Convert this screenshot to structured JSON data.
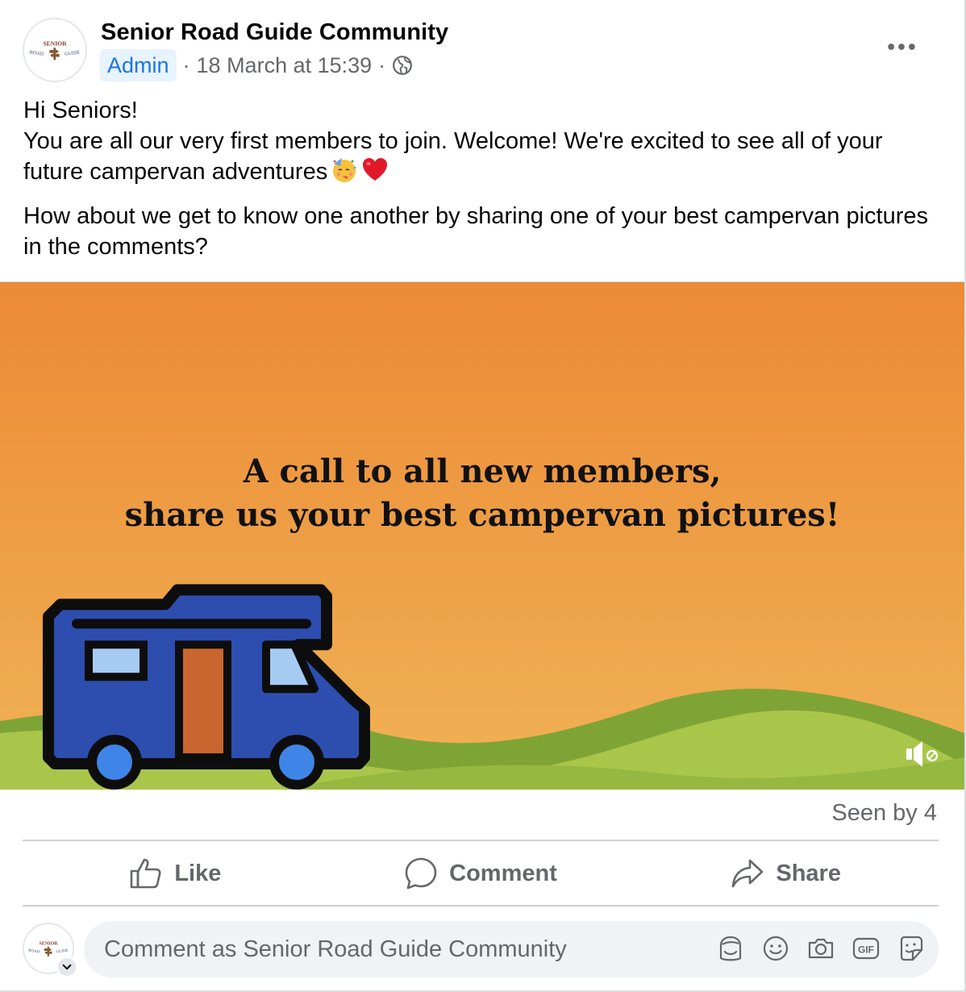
{
  "post": {
    "group_name": "Senior Road Guide Community",
    "role_badge": "Admin",
    "separator": "·",
    "timestamp": "18 March at 15:39",
    "separator2": "·",
    "privacy_icon": "globe-icon",
    "more_icon": "more-options-icon"
  },
  "logo": {
    "line1": "SENIOR",
    "line2": "ROAD",
    "line3": "GUIDE"
  },
  "body": {
    "greeting": "Hi Seniors!",
    "paragraph1": "You are all our very first members to join. Welcome! We're excited to see all of your future campervan adventures",
    "emojis": [
      "partying-face-emoji",
      "red-heart-emoji"
    ],
    "paragraph2": "How about we get to know one another by sharing one of your best campervan pictures in the comments?"
  },
  "media": {
    "headline_line1": "A call to all new members,",
    "headline_line2": "share us your best campervan pictures!",
    "mute_icon": "sound-muted-icon",
    "colors": {
      "sky_top": "#ec8a35",
      "sky_bottom": "#f0b053",
      "hill_dark": "#7fa436",
      "hill_light": "#a9c64a",
      "van": "#2d4eae",
      "door": "#c9652f"
    }
  },
  "stats": {
    "seen_by": "Seen by 4"
  },
  "actions": {
    "like": "Like",
    "comment": "Comment",
    "share": "Share"
  },
  "composer": {
    "placeholder": "Comment as Senior Road Guide Community",
    "icons": [
      "avatar-sticker-icon",
      "emoji-icon",
      "camera-icon",
      "gif-icon",
      "sticker-icon"
    ]
  }
}
